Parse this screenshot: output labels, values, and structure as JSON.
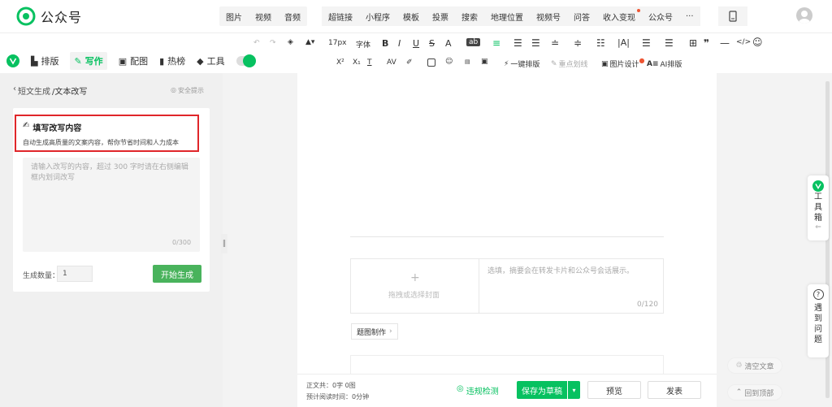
{
  "topbar": {
    "app_name": "公众号",
    "menu1": [
      "图片",
      "视频",
      "音频"
    ],
    "menu2": [
      "超链接",
      "小程序",
      "模板",
      "投票",
      "搜索",
      "地理位置",
      "视频号",
      "问答",
      "收入变现",
      "公众号",
      "···"
    ]
  },
  "toolbar": {
    "font_size": "17px",
    "font": "字体",
    "bold": "B",
    "italic": "I",
    "underline": "U",
    "strike": "S",
    "font_color": "A",
    "bg_color": "ab",
    "superscript": "X²",
    "subscript": "X₁",
    "one_key_layout": "一键排版",
    "key_line": "重点划线",
    "image_design": "图片设计",
    "ai_layout": "AI排版"
  },
  "modes": [
    "排版",
    "写作",
    "配图",
    "热榜",
    "工具"
  ],
  "left": {
    "breadcrumb_1": "短文生成",
    "breadcrumb_2": "/文本改写",
    "safety": "安全提示",
    "card_title": "填写改写内容",
    "card_desc": "自动生成高质量的文案内容，帮你节省时间和人力成本",
    "placeholder": "请输入改写的内容，超过 300 字时请在右侧编辑框内划词改写",
    "counter": "0/300",
    "quantity_label": "生成数量：",
    "quantity_value": "1",
    "generate": "开始生成"
  },
  "editor": {
    "cover_text": "拖拽或选择封面",
    "summary_placeholder": "选填，摘要会在转发卡片和公众号会话展示。",
    "summary_count": "0/120",
    "image_make": "题图制作"
  },
  "bottom": {
    "word_count": "正文共：0字 0图",
    "read_time": "预计阅读时间：0分钟",
    "compliance": "违规检测",
    "save": "保存为草稿",
    "preview": "预览",
    "publish": "发表"
  },
  "side": {
    "toolbox": [
      "工",
      "具",
      "箱"
    ],
    "problem": [
      "遇",
      "到",
      "问",
      "题"
    ],
    "clear": "清空文章",
    "back_top": "回到顶部"
  },
  "colors": {
    "brand": "#07c160",
    "button_green": "#49b35c",
    "highlight_red": "#e0262a"
  }
}
